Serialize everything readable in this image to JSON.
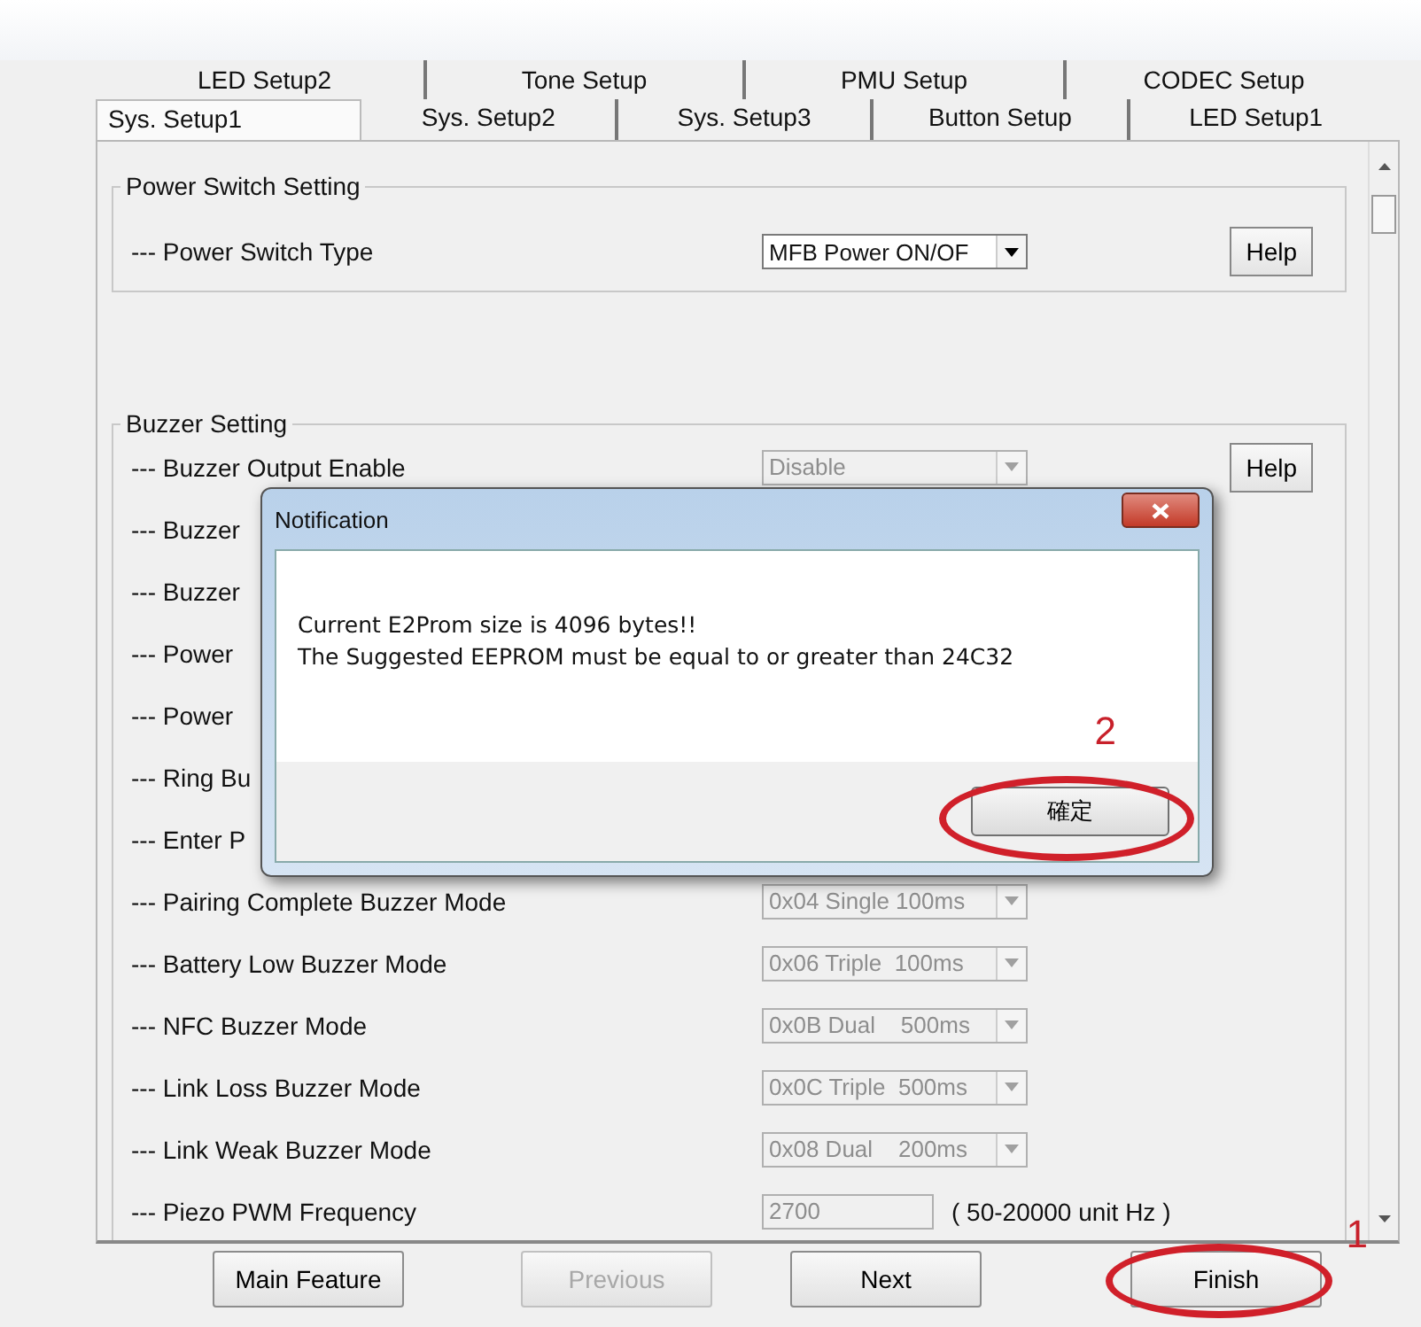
{
  "tabs": {
    "back_row": [
      {
        "label": "LED Setup2",
        "selected": false
      },
      {
        "label": "Tone Setup",
        "selected": false
      },
      {
        "label": "PMU Setup",
        "selected": false
      },
      {
        "label": "CODEC Setup",
        "selected": false
      }
    ],
    "front_row": [
      {
        "label": "Sys. Setup1",
        "selected": true
      },
      {
        "label": "Sys. Setup2",
        "selected": false
      },
      {
        "label": "Sys. Setup3",
        "selected": false
      },
      {
        "label": "Button Setup",
        "selected": false
      },
      {
        "label": "LED Setup1",
        "selected": false
      }
    ]
  },
  "groups": [
    {
      "title": "Power Switch Setting",
      "rows": [
        {
          "label": "--- Power Switch Type",
          "kind": "dropdown",
          "value": "MFB Power ON/OF",
          "disabled": false,
          "help": "Help"
        }
      ]
    },
    {
      "title": "Buzzer Setting",
      "rows": [
        {
          "label": "--- Buzzer Output Enable",
          "kind": "dropdown",
          "value": "Disable",
          "disabled": true,
          "help": "Help"
        },
        {
          "label": "--- Buzzer",
          "kind": "hidden"
        },
        {
          "label": "--- Buzzer",
          "kind": "hidden"
        },
        {
          "label": "--- Power",
          "kind": "hidden"
        },
        {
          "label": "--- Power",
          "kind": "hidden"
        },
        {
          "label": "--- Ring Bu",
          "kind": "hidden"
        },
        {
          "label": "--- Enter P",
          "kind": "hidden"
        },
        {
          "label": "--- Pairing Complete Buzzer Mode",
          "kind": "dropdown",
          "value": "0x04 Single 100ms",
          "disabled": true
        },
        {
          "label": "--- Battery Low Buzzer Mode",
          "kind": "dropdown",
          "value": "0x06 Triple  100ms",
          "disabled": true
        },
        {
          "label": "--- NFC Buzzer Mode",
          "kind": "dropdown",
          "value": "0x0B Dual    500ms",
          "disabled": true
        },
        {
          "label": "--- Link Loss Buzzer Mode",
          "kind": "dropdown",
          "value": "0x0C Triple  500ms",
          "disabled": true
        },
        {
          "label": "--- Link Weak Buzzer Mode",
          "kind": "dropdown",
          "value": "0x08 Dual    200ms",
          "disabled": true
        },
        {
          "label": "--- Piezo PWM Frequency",
          "kind": "text",
          "value": "2700",
          "disabled": true,
          "unit": "( 50-20000 unit Hz )"
        }
      ]
    }
  ],
  "dialog": {
    "title": "Notification",
    "lines": [
      "Current E2Prom size is 4096 bytes!!",
      "The Suggested EEPROM must be equal to or greater than 24C32"
    ],
    "ok": "確定",
    "marker": "2"
  },
  "buttons": [
    {
      "label": "Main Feature",
      "disabled": false
    },
    {
      "label": "Previous",
      "disabled": true
    },
    {
      "label": "Next",
      "disabled": false
    },
    {
      "label": "Finish",
      "disabled": false,
      "marker": "1"
    }
  ]
}
